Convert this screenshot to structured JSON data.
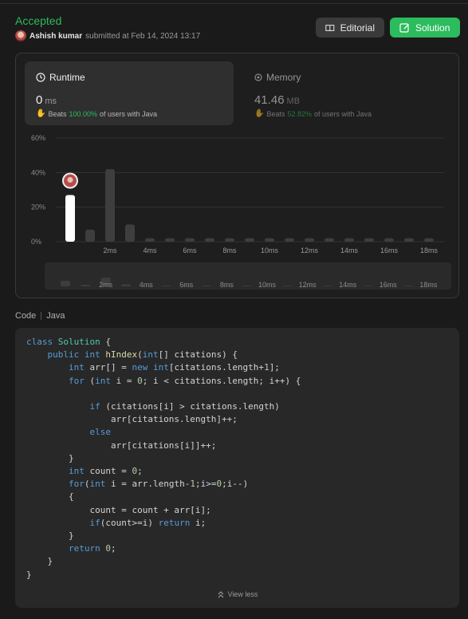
{
  "submission": {
    "status": "Accepted",
    "author": "Ashish kumar",
    "submitted_text": "submitted at Feb 14, 2024 13:17"
  },
  "buttons": {
    "editorial": "Editorial",
    "solution": "Solution"
  },
  "runtime": {
    "label": "Runtime",
    "value": "0",
    "unit": "ms",
    "beats_prefix": "Beats",
    "beats_pct": "100.00%",
    "beats_suffix": "of users with Java"
  },
  "memory": {
    "label": "Memory",
    "value": "41.46",
    "unit": "MB",
    "beats_prefix": "Beats",
    "beats_pct": "52.82%",
    "beats_suffix": "of users with Java"
  },
  "colors": {
    "accent": "#2cbb5d",
    "bar": "#3e3e3e",
    "bar_selected": "#ffffff"
  },
  "chart_data": {
    "type": "bar",
    "y_ticks": [
      "60%",
      "40%",
      "20%",
      "0%"
    ],
    "ylim": [
      0,
      60
    ],
    "x_tick_labels": [
      "2ms",
      "4ms",
      "6ms",
      "8ms",
      "10ms",
      "12ms",
      "14ms",
      "16ms",
      "18ms"
    ],
    "values": [
      27,
      7,
      42,
      10,
      2,
      2,
      2,
      2,
      2,
      2,
      2,
      2,
      2,
      2,
      2,
      2,
      2,
      2,
      2
    ],
    "selected_index": 0,
    "grid": true
  },
  "code_section": {
    "label": "Code",
    "language": "Java",
    "view_less": "View less"
  },
  "icons": {
    "editorial": "book-icon",
    "solution": "edit-icon",
    "runtime": "clock-icon",
    "memory": "chip-icon",
    "beats": "hands-icon",
    "view_less": "chevrons-up-icon"
  }
}
